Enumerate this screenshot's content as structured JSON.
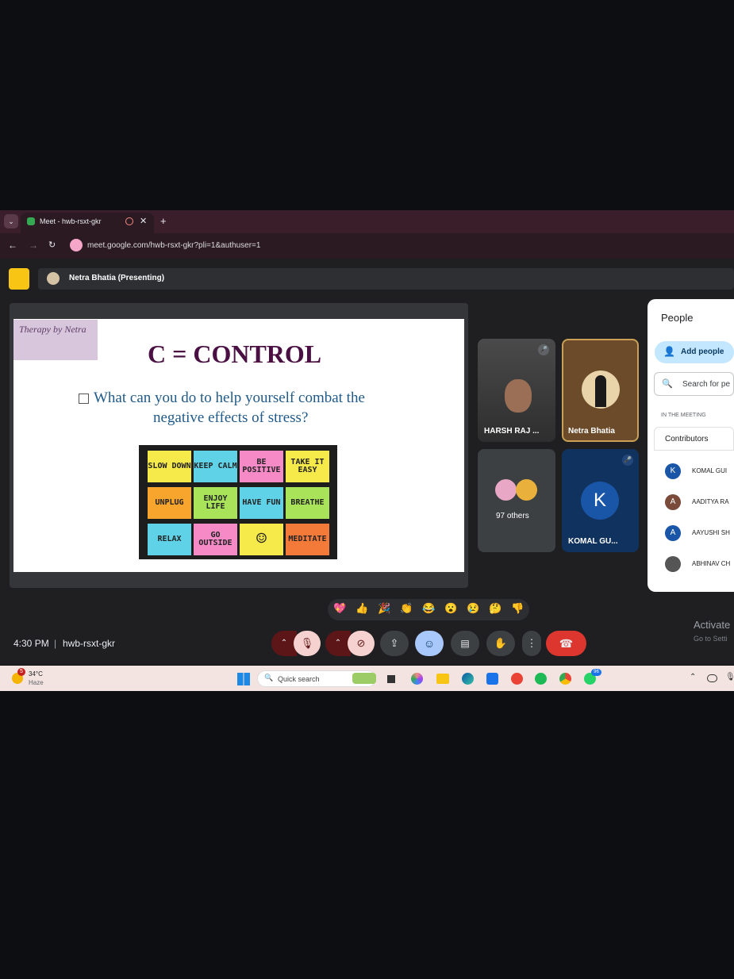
{
  "browser": {
    "tab_title": "Meet - hwb-rsxt-gkr",
    "new_tab": "+",
    "url": "meet.google.com/hwb-rsxt-gkr?pli=1&authuser=1"
  },
  "meet": {
    "presenting_label": "Netra Bhatia (Presenting)",
    "slide": {
      "logo_text": "Therapy by Netra",
      "title": "C = CONTROL",
      "question_line1": "What can you do to help yourself combat the",
      "question_line2": "negative effects of stress?",
      "notes": [
        {
          "text": "SLOW DOWN",
          "color": "#f6e94a"
        },
        {
          "text": "KEEP CALM",
          "color": "#5fd2e8"
        },
        {
          "text": "BE POSITIVE",
          "color": "#f58ac6"
        },
        {
          "text": "TAKE IT EASY",
          "color": "#f6e94a"
        },
        {
          "text": "UNPLUG",
          "color": "#f7a52c"
        },
        {
          "text": "ENJOY LIFE",
          "color": "#a8e35a"
        },
        {
          "text": "HAVE FUN",
          "color": "#5fd2e8"
        },
        {
          "text": "BREATHE",
          "color": "#a8e35a"
        },
        {
          "text": "RELAX",
          "color": "#5fd2e8"
        },
        {
          "text": "GO OUTSIDE",
          "color": "#f58ac6"
        },
        {
          "text": "☺",
          "color": "#f6e94a"
        },
        {
          "text": "MEDITATE",
          "color": "#f47a3a"
        }
      ]
    },
    "tiles": {
      "harsh_name": "HARSH RAJ ...",
      "netra_name": "Netra Bhatia",
      "others_label": "97 others",
      "komal_initial": "K",
      "komal_name": "KOMAL GU..."
    },
    "people": {
      "title": "People",
      "add_people": "Add people",
      "search_placeholder": "Search for pe",
      "section": "IN THE MEETING",
      "contributors": "Contributors",
      "list": [
        {
          "initial": "K",
          "name": "KOMAL GUI",
          "color": "#1a56a8"
        },
        {
          "initial": "A",
          "name": "AADITYA RA",
          "color": "#7a4a3a"
        },
        {
          "initial": "A",
          "name": "AAYUSHI SH",
          "color": "#1a56a8"
        },
        {
          "initial": "",
          "name": "ABHINAV CH",
          "color": "#555555"
        }
      ]
    },
    "reactions": [
      "💖",
      "👍",
      "🎉",
      "👏",
      "😂",
      "😮",
      "😢",
      "🤔",
      "👎"
    ],
    "time": "4:30 PM",
    "separator": "|",
    "meeting_code": "hwb-rsxt-gkr",
    "activate_title": "Activate",
    "activate_sub": "Go to Setti"
  },
  "taskbar": {
    "temp": "34°C",
    "weather": "Haze",
    "weather_badge": "5",
    "search_placeholder": "Quick search",
    "badge_count": "96"
  }
}
